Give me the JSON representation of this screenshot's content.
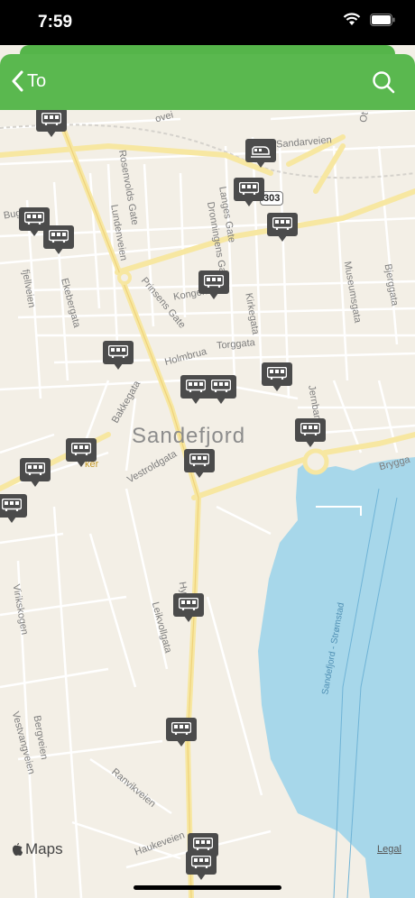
{
  "status": {
    "time": "7:59"
  },
  "nav": {
    "back_label": "To"
  },
  "map": {
    "city": "Sandefjord",
    "water_label": "Sandefjord - Strømstad",
    "road_shield": "303",
    "attribution": "Maps",
    "legal": "Legal",
    "streets": {
      "rosenvolds_gate": "Rosenvolds Gate",
      "lundenveien": "Lundenveien",
      "langes_gate": "Langes Gate",
      "dronningens_gate": "Dronningens Gate",
      "kongens_gate": "Kongens",
      "kirkegata": "Kirkegata",
      "museumsgata": "Museumsgata",
      "bjerggata": "Bjerggata",
      "prinsens_gate": "Prinsens Gate",
      "torggata": "Torggata",
      "holmbrua": "Holmbrua",
      "sandarveien": "Sandarveien",
      "bugaardsgata": "Bug",
      "fjellveien": "fjellveien",
      "ekebergata": "Ekebergata",
      "bakkegata": "Bakkegata",
      "vestroldgata": "Vestroldgata",
      "jernbanealleen": "Jernbane",
      "brygga": "Brygga",
      "hystadveien": "Hy",
      "leikvollgata": "Leikvollgata",
      "virikskogen": "Virikskogen",
      "bergveien": "Bergveien",
      "vestvangveien": "Vestvangveien",
      "ranvikveien": "Ranvikveien",
      "haukeveien": "Haukeveien",
      "torget": "ker",
      "partial_top_left": "ovei",
      "partial_top_right": "Ot"
    }
  }
}
